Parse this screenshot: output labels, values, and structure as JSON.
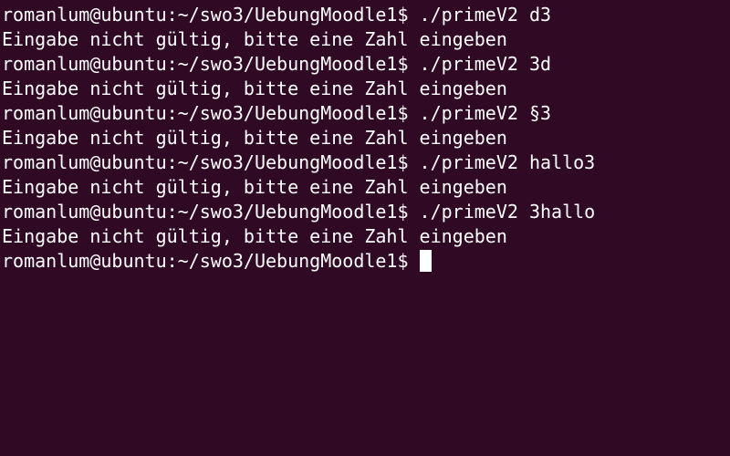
{
  "terminal": {
    "colors": {
      "background": "#300a24",
      "foreground": "#ffffff"
    },
    "lines": [
      "romanlum@ubuntu:~/swo3/UebungMoodle1$ ./primeV2 d3",
      "Eingabe nicht gültig, bitte eine Zahl eingeben",
      "romanlum@ubuntu:~/swo3/UebungMoodle1$ ./primeV2 3d",
      "Eingabe nicht gültig, bitte eine Zahl eingeben",
      "romanlum@ubuntu:~/swo3/UebungMoodle1$ ./primeV2 §3",
      "Eingabe nicht gültig, bitte eine Zahl eingeben",
      "romanlum@ubuntu:~/swo3/UebungMoodle1$ ./primeV2 hallo3",
      "Eingabe nicht gültig, bitte eine Zahl eingeben",
      "romanlum@ubuntu:~/swo3/UebungMoodle1$ ./primeV2 3hallo",
      "Eingabe nicht gültig, bitte eine Zahl eingeben"
    ],
    "prompt": "romanlum@ubuntu:~/swo3/UebungMoodle1$ "
  }
}
